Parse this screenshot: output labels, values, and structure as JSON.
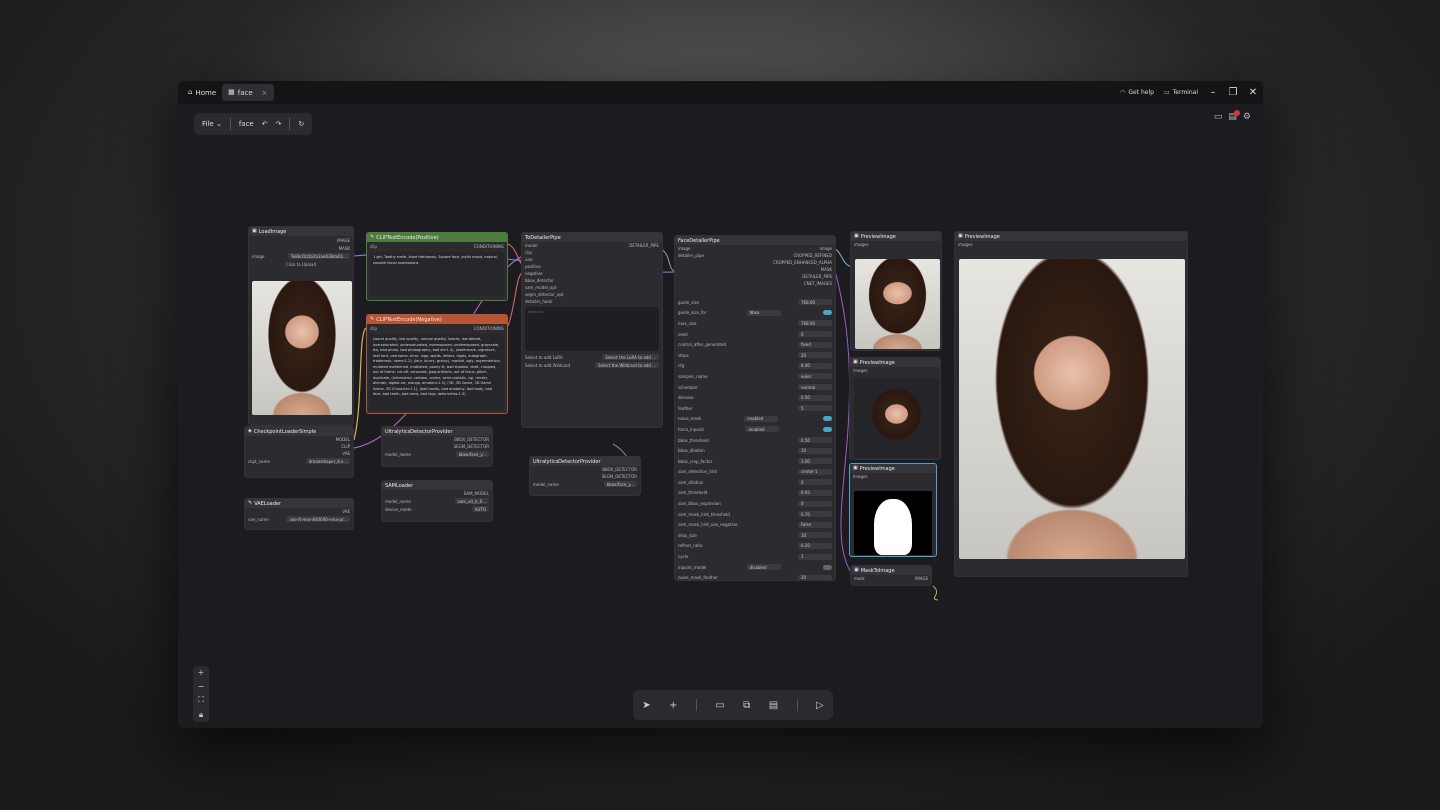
{
  "titlebar": {
    "home": "Home",
    "tab": "face",
    "tab_close": "×",
    "get_help": "Get help",
    "terminal": "Terminal"
  },
  "menu": {
    "file": "File",
    "workflow": "face"
  },
  "nodes": {
    "loadimage": {
      "title": "LoadImage",
      "out1": "IMAGE",
      "out2": "MASK",
      "image_label": "image",
      "image_val": "Te8bd1b5b2b3ae638da61...",
      "upload": "Click to Upload"
    },
    "checkpoint": {
      "title": "CheckpointLoaderSimple",
      "o1": "MODEL",
      "o2": "CLIP",
      "o3": "VAE",
      "label": "ckpt_name",
      "val": "dreamshaper_8.s..."
    },
    "vae": {
      "title": "VAELoader",
      "o1": "VAE",
      "label": "vae_name",
      "val": "vae-ft-mse-840000-ema-pr..."
    },
    "pos": {
      "title": "CLIPTextEncode(Positive)",
      "in": "clip",
      "out": "CONDITIONING",
      "text": "1 girl,  Toothy smile,  Anne Hathaway,  Square face,  Joyful mood, natural, smooth facial expressions"
    },
    "neg": {
      "title": "CLIPTextEncode(Negative)",
      "in": "clip",
      "out": "CONDITIONING",
      "text": "(worst quality, low quality, normal quality, lowres, low details, oversaturated, undersaturated, overexposed, underexposed, grayscale, bw, bad photo, bad photography, bad art:1.4), (watermark, signature, text font, username, error, logo, words, letters, digits, autograph, trademark, name:1.2), (blur, blurry, grainy), morbid, ugly, asymmetrical, mutated malformed, mutilated, poorly lit, bad shadow, draft, cropped, out of frame, cut off, censored, jpeg artifacts, out of focus, glitch, duplicate, (airbrushed, cartoon, anime, semi-realistic, cgi, render, blender, digital art, manga, amateur:1.3), (3D ,3D Game, 3D Game Scene, 3D Character:1.1), (bad hands, bad anatomy, bad body, bad face, bad teeth, bad arms, bad legs, deformities:1.3)"
    },
    "ultra1": {
      "title": "UltralyticsDetectorProvider",
      "o1": "BBOX_DETECTOR",
      "o2": "SEGM_DETECTOR",
      "label": "model_name",
      "val": "bbox/face_y..."
    },
    "sam": {
      "title": "SAMLoader",
      "o1": "SAM_MODEL",
      "l1": "model_name",
      "v1": "sam_vit_b_0...",
      "l2": "device_mode",
      "v2": "AUTO"
    },
    "todetailer": {
      "title": "ToDetailerPipe",
      "out": "DETAILER_PIPE",
      "ins": [
        "model",
        "clip",
        "vae",
        "positive",
        "negative",
        "bbox_detector",
        "sam_model_opt",
        "segm_detector_opt",
        "detailer_hook"
      ],
      "wildcard": "wildcard",
      "lora_l": "Select to add LoRA",
      "lora_v": "Select the LoRA to add ...",
      "wc_l": "Select to add Wildcard",
      "wc_v": "Select the Wildcard to add ..."
    },
    "ultra2": {
      "title": "UltralyticsDetectorProvider",
      "o1": "BBOX_DETECTOR",
      "o2": "SEGM_DETECTOR",
      "label": "model_name",
      "val": "bbox/face_y..."
    },
    "face": {
      "title": "FaceDetailerPipe",
      "in1": "image",
      "in2": "detailer_pipe",
      "outs": [
        "image",
        "CROPPED_REFINED",
        "CROPPED_ENHANCED_ALPHA",
        "MASK",
        "DETAILER_PIPE",
        "CNET_IMAGES"
      ],
      "rows": [
        [
          "guide_size",
          "768.00"
        ],
        [
          "guide_size_for",
          "bbox"
        ],
        [
          "max_size",
          "768.00"
        ],
        [
          "seed",
          "0"
        ],
        [
          "control_after_generated",
          "fixed"
        ],
        [
          "steps",
          "20"
        ],
        [
          "cfg",
          "8.00"
        ],
        [
          "sampler_name",
          "euler"
        ],
        [
          "scheduler",
          "normal"
        ],
        [
          "denoise",
          "0.50"
        ],
        [
          "feather",
          "5"
        ],
        [
          "noise_mask",
          "enabled"
        ],
        [
          "force_inpaint",
          "enabled"
        ],
        [
          "bbox_threshold",
          "0.50"
        ],
        [
          "bbox_dilation",
          "10"
        ],
        [
          "bbox_crop_factor",
          "3.00"
        ],
        [
          "sam_detection_hint",
          "center-1"
        ],
        [
          "sam_dilation",
          "0"
        ],
        [
          "sam_threshold",
          "0.93"
        ],
        [
          "sam_bbox_expansion",
          "0"
        ],
        [
          "sam_mask_hint_threshold",
          "0.70"
        ],
        [
          "sam_mask_hint_use_negative",
          "False"
        ],
        [
          "drop_size",
          "10"
        ],
        [
          "refiner_ratio",
          "0.20"
        ],
        [
          "cycle",
          "1"
        ],
        [
          "inpaint_model",
          "disabled"
        ],
        [
          "noise_mask_feather",
          "20"
        ]
      ]
    },
    "prev1": {
      "title": "PreviewImage",
      "in": "images"
    },
    "prev2": {
      "title": "PreviewImage",
      "in": "images"
    },
    "prev3": {
      "title": "PreviewImage",
      "in": "images"
    },
    "mask": {
      "title": "MaskToImage",
      "in": "mask",
      "out": "IMAGE"
    },
    "prevbig": {
      "title": "PreviewImage",
      "in": "images"
    }
  },
  "colors": {
    "positive": "#4c7c3e",
    "negative": "#b55637",
    "accent": "#4aa6c9"
  }
}
